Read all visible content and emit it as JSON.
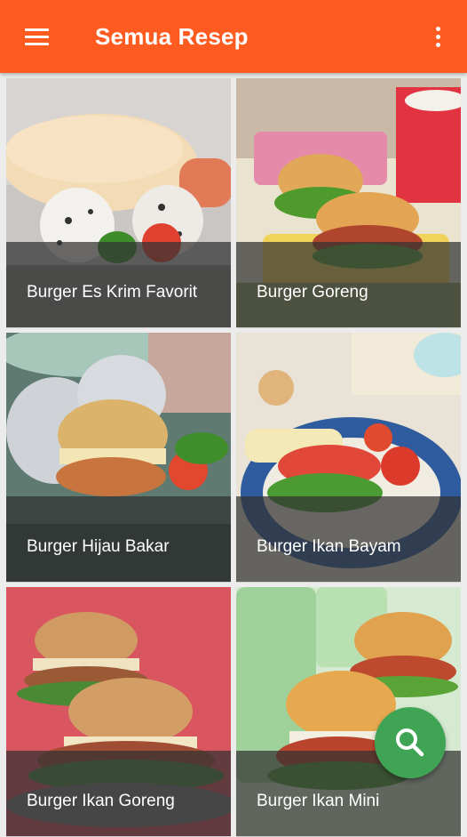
{
  "app_bar": {
    "title": "Semua Resep",
    "menu_icon": "hamburger-menu-icon",
    "overflow_icon": "more-vertical-icon",
    "color": "#fd5b20"
  },
  "recipes": [
    {
      "title": "Burger Es Krim Favorit"
    },
    {
      "title": "Burger Goreng"
    },
    {
      "title": "Burger Hijau Bakar"
    },
    {
      "title": "Burger Ikan Bayam"
    },
    {
      "title": "Burger Ikan Goreng"
    },
    {
      "title": "Burger Ikan Mini"
    }
  ],
  "fab": {
    "icon": "search-icon",
    "color": "#3fa555"
  }
}
